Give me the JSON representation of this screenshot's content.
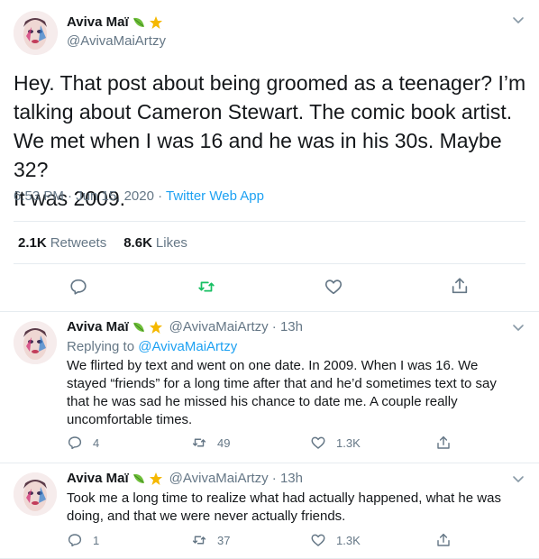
{
  "main_tweet": {
    "name": "Aviva Maï",
    "handle": "@AvivaMaiArtzy",
    "text_lines": [
      "Hey. That post about being groomed as a teenager? I’m",
      "talking about Cameron Stewart. The comic book artist.",
      "We met when I was 16 and he was in his 30s. Maybe 32?",
      "It was 2009."
    ],
    "time": "6:53 PM · Jun 15, 2020 · ",
    "app": "Twitter Web App",
    "retweets_count": "2.1K",
    "retweets_label": "Retweets",
    "likes_count": "8.6K",
    "likes_label": "Likes",
    "icons": [
      "reply-icon",
      "retweet-icon",
      "like-icon",
      "share-icon"
    ]
  },
  "replies": [
    {
      "name": "Aviva Maï",
      "handle": "@AvivaMaiArtzy · 13h",
      "replying_prefix": "Replying to ",
      "replying_to": "@AvivaMaiArtzy",
      "text_lines": [
        "We flirted by text and went on one date. In 2009. When I was 16. We",
        "stayed “friends” for a long time after that and he’d sometimes text to say",
        "that he was sad he missed his chance to date me. A couple really",
        "uncomfortable times."
      ],
      "reply_count": "4",
      "retweet_count": "49",
      "like_count": "1.3K"
    },
    {
      "name": "Aviva Maï",
      "handle": "@AvivaMaiArtzy · 13h",
      "text_lines": [
        "Took me a long time to realize what had actually happened, what he was",
        "doing, and that we were never actually friends."
      ],
      "reply_count": "1",
      "retweet_count": "37",
      "like_count": "1.3K"
    }
  ],
  "colors": {
    "accent": "#1da1f2",
    "retweet_green": "#17bf63",
    "secondary_text": "#657786",
    "border": "#e6ecf0"
  }
}
